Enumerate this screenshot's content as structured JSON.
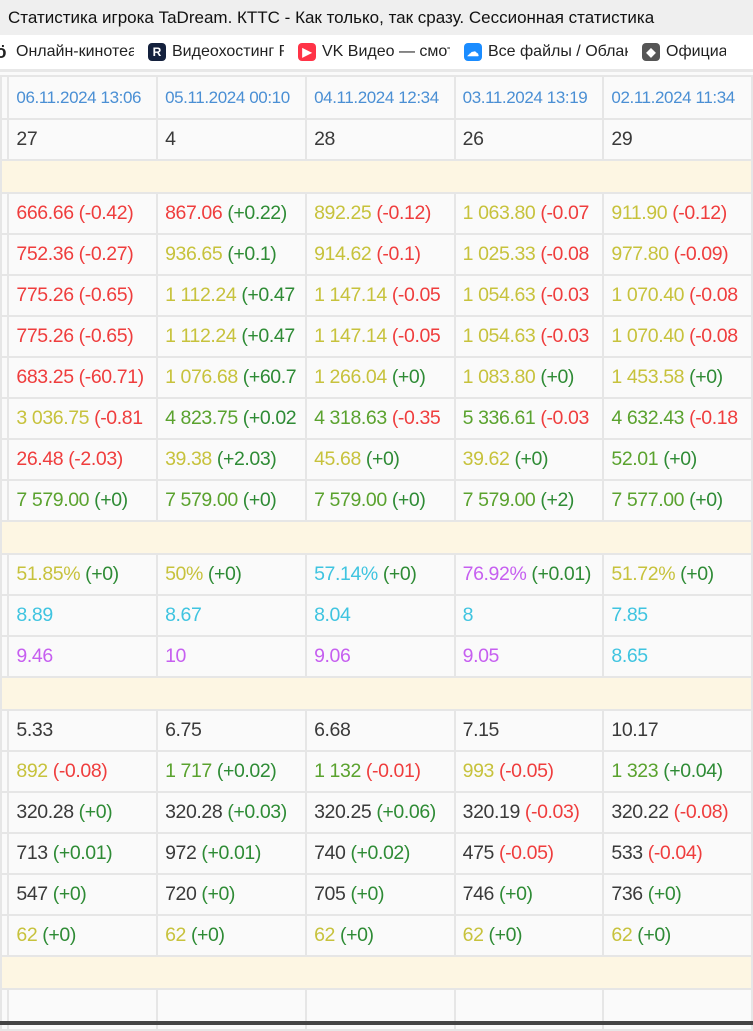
{
  "window": {
    "title": "Статистика игрока TaDream. КТТС - Как только, так сразу. Сессионная статистика"
  },
  "bookmarks": [
    {
      "label": "Онлайн-кинотеатр",
      "icon": "kinopoisk-icon",
      "color": "#222222",
      "glyph": "ö"
    },
    {
      "label": "Видеохостинг RUTUBE",
      "icon": "rutube-icon",
      "color": "#14213d",
      "glyph": "R"
    },
    {
      "label": "VK Видео — смотреть",
      "icon": "vk-video-icon",
      "color": "#ff3347",
      "glyph": "▶"
    },
    {
      "label": "Все файлы / Облако",
      "icon": "cloud-icon",
      "color": "#1a8cff",
      "glyph": "☁"
    },
    {
      "label": "Официальный",
      "icon": "shield-icon",
      "color": "#555555",
      "glyph": "◆"
    }
  ],
  "colors": {
    "red": "#ef3d3d",
    "yellow": "#c7c23c",
    "green": "#5aa22e",
    "dgreen": "#2e8b35",
    "cyan": "#3fc4e0",
    "purple": "#c65ff0",
    "dark": "#3a3a3a"
  },
  "table": {
    "dates": [
      "06.11.2024 13:06",
      "05.11.2024 00:10",
      "04.11.2024 12:34",
      "03.11.2024 13:19",
      "02.11.2024 11:34"
    ],
    "sections": [
      {
        "rows": [
          [
            {
              "v": "27",
              "vc": "dark"
            },
            {
              "v": "4",
              "vc": "dark"
            },
            {
              "v": "28",
              "vc": "dark"
            },
            {
              "v": "26",
              "vc": "dark"
            },
            {
              "v": "29",
              "vc": "dark"
            }
          ]
        ]
      },
      {
        "rows": [
          [
            {
              "v": "666.66",
              "vc": "red",
              "d": "(-0.42)",
              "dc": "red"
            },
            {
              "v": "867.06",
              "vc": "red",
              "d": "(+0.22)",
              "dc": "dgreen"
            },
            {
              "v": "892.25",
              "vc": "yellow",
              "d": "(-0.12)",
              "dc": "red"
            },
            {
              "v": "1 063.80",
              "vc": "yellow",
              "d": "(-0.07",
              "dc": "red"
            },
            {
              "v": "911.90",
              "vc": "yellow",
              "d": "(-0.12)",
              "dc": "red"
            }
          ],
          [
            {
              "v": "752.36",
              "vc": "red",
              "d": "(-0.27)",
              "dc": "red"
            },
            {
              "v": "936.65",
              "vc": "yellow",
              "d": "(+0.1)",
              "dc": "dgreen"
            },
            {
              "v": "914.62",
              "vc": "yellow",
              "d": "(-0.1)",
              "dc": "red"
            },
            {
              "v": "1 025.33",
              "vc": "yellow",
              "d": "(-0.08",
              "dc": "red"
            },
            {
              "v": "977.80",
              "vc": "yellow",
              "d": "(-0.09)",
              "dc": "red"
            }
          ],
          [
            {
              "v": "775.26",
              "vc": "red",
              "d": "(-0.65)",
              "dc": "red"
            },
            {
              "v": "1 112.24",
              "vc": "yellow",
              "d": "(+0.47",
              "dc": "dgreen"
            },
            {
              "v": "1 147.14",
              "vc": "yellow",
              "d": "(-0.05",
              "dc": "red"
            },
            {
              "v": "1 054.63",
              "vc": "yellow",
              "d": "(-0.03",
              "dc": "red"
            },
            {
              "v": "1 070.40",
              "vc": "yellow",
              "d": "(-0.08",
              "dc": "red"
            }
          ],
          [
            {
              "v": "775.26",
              "vc": "red",
              "d": "(-0.65)",
              "dc": "red"
            },
            {
              "v": "1 112.24",
              "vc": "yellow",
              "d": "(+0.47",
              "dc": "dgreen"
            },
            {
              "v": "1 147.14",
              "vc": "yellow",
              "d": "(-0.05",
              "dc": "red"
            },
            {
              "v": "1 054.63",
              "vc": "yellow",
              "d": "(-0.03",
              "dc": "red"
            },
            {
              "v": "1 070.40",
              "vc": "yellow",
              "d": "(-0.08",
              "dc": "red"
            }
          ],
          [
            {
              "v": "683.25",
              "vc": "red",
              "d": "(-60.71)",
              "dc": "red"
            },
            {
              "v": "1 076.68",
              "vc": "yellow",
              "d": "(+60.7",
              "dc": "dgreen"
            },
            {
              "v": "1 266.04",
              "vc": "yellow",
              "d": "(+0)",
              "dc": "dgreen"
            },
            {
              "v": "1 083.80",
              "vc": "yellow",
              "d": "(+0)",
              "dc": "dgreen"
            },
            {
              "v": "1 453.58",
              "vc": "yellow",
              "d": "(+0)",
              "dc": "dgreen"
            }
          ],
          [
            {
              "v": "3 036.75",
              "vc": "yellow",
              "d": "(-0.81",
              "dc": "red"
            },
            {
              "v": "4 823.75",
              "vc": "green",
              "d": "(+0.02",
              "dc": "dgreen"
            },
            {
              "v": "4 318.63",
              "vc": "green",
              "d": "(-0.35",
              "dc": "red"
            },
            {
              "v": "5 336.61",
              "vc": "green",
              "d": "(-0.03",
              "dc": "red"
            },
            {
              "v": "4 632.43",
              "vc": "green",
              "d": "(-0.18",
              "dc": "red"
            }
          ],
          [
            {
              "v": "26.48",
              "vc": "red",
              "d": "(-2.03)",
              "dc": "red"
            },
            {
              "v": "39.38",
              "vc": "yellow",
              "d": "(+2.03)",
              "dc": "dgreen"
            },
            {
              "v": "45.68",
              "vc": "yellow",
              "d": "(+0)",
              "dc": "dgreen"
            },
            {
              "v": "39.62",
              "vc": "yellow",
              "d": "(+0)",
              "dc": "dgreen"
            },
            {
              "v": "52.01",
              "vc": "green",
              "d": "(+0)",
              "dc": "dgreen"
            }
          ],
          [
            {
              "v": "7 579.00",
              "vc": "green",
              "d": "(+0)",
              "dc": "dgreen"
            },
            {
              "v": "7 579.00",
              "vc": "green",
              "d": "(+0)",
              "dc": "dgreen"
            },
            {
              "v": "7 579.00",
              "vc": "green",
              "d": "(+0)",
              "dc": "dgreen"
            },
            {
              "v": "7 579.00",
              "vc": "green",
              "d": "(+2)",
              "dc": "dgreen"
            },
            {
              "v": "7 577.00",
              "vc": "green",
              "d": "(+0)",
              "dc": "dgreen"
            }
          ]
        ]
      },
      {
        "rows": [
          [
            {
              "v": "51.85%",
              "vc": "yellow",
              "d": "(+0)",
              "dc": "dgreen"
            },
            {
              "v": "50%",
              "vc": "yellow",
              "d": "(+0)",
              "dc": "dgreen"
            },
            {
              "v": "57.14%",
              "vc": "cyan",
              "d": "(+0)",
              "dc": "dgreen"
            },
            {
              "v": "76.92%",
              "vc": "purple",
              "d": "(+0.01)",
              "dc": "dgreen"
            },
            {
              "v": "51.72%",
              "vc": "yellow",
              "d": "(+0)",
              "dc": "dgreen"
            }
          ],
          [
            {
              "v": "8.89",
              "vc": "cyan"
            },
            {
              "v": "8.67",
              "vc": "cyan"
            },
            {
              "v": "8.04",
              "vc": "cyan"
            },
            {
              "v": "8",
              "vc": "cyan"
            },
            {
              "v": "7.85",
              "vc": "cyan"
            }
          ],
          [
            {
              "v": "9.46",
              "vc": "purple"
            },
            {
              "v": "10",
              "vc": "purple"
            },
            {
              "v": "9.06",
              "vc": "purple"
            },
            {
              "v": "9.05",
              "vc": "purple"
            },
            {
              "v": "8.65",
              "vc": "cyan"
            }
          ]
        ]
      },
      {
        "rows": [
          [
            {
              "v": "5.33",
              "vc": "dark"
            },
            {
              "v": "6.75",
              "vc": "dark"
            },
            {
              "v": "6.68",
              "vc": "dark"
            },
            {
              "v": "7.15",
              "vc": "dark"
            },
            {
              "v": "10.17",
              "vc": "dark"
            }
          ],
          [
            {
              "v": "892",
              "vc": "yellow",
              "d": "(-0.08)",
              "dc": "red"
            },
            {
              "v": "1 717",
              "vc": "green",
              "d": "(+0.02)",
              "dc": "dgreen"
            },
            {
              "v": "1 132",
              "vc": "green",
              "d": "(-0.01)",
              "dc": "red"
            },
            {
              "v": "993",
              "vc": "yellow",
              "d": "(-0.05)",
              "dc": "red"
            },
            {
              "v": "1 323",
              "vc": "green",
              "d": "(+0.04)",
              "dc": "dgreen"
            }
          ],
          [
            {
              "v": "320.28",
              "vc": "dark",
              "d": "(+0)",
              "dc": "dgreen"
            },
            {
              "v": "320.28",
              "vc": "dark",
              "d": "(+0.03)",
              "dc": "dgreen"
            },
            {
              "v": "320.25",
              "vc": "dark",
              "d": "(+0.06)",
              "dc": "dgreen"
            },
            {
              "v": "320.19",
              "vc": "dark",
              "d": "(-0.03)",
              "dc": "red"
            },
            {
              "v": "320.22",
              "vc": "dark",
              "d": "(-0.08)",
              "dc": "red"
            }
          ],
          [
            {
              "v": "713",
              "vc": "dark",
              "d": "(+0.01)",
              "dc": "dgreen"
            },
            {
              "v": "972",
              "vc": "dark",
              "d": "(+0.01)",
              "dc": "dgreen"
            },
            {
              "v": "740",
              "vc": "dark",
              "d": "(+0.02)",
              "dc": "dgreen"
            },
            {
              "v": "475",
              "vc": "dark",
              "d": "(-0.05)",
              "dc": "red"
            },
            {
              "v": "533",
              "vc": "dark",
              "d": "(-0.04)",
              "dc": "red"
            }
          ],
          [
            {
              "v": "547",
              "vc": "dark",
              "d": "(+0)",
              "dc": "dgreen"
            },
            {
              "v": "720",
              "vc": "dark",
              "d": "(+0)",
              "dc": "dgreen"
            },
            {
              "v": "705",
              "vc": "dark",
              "d": "(+0)",
              "dc": "dgreen"
            },
            {
              "v": "746",
              "vc": "dark",
              "d": "(+0)",
              "dc": "dgreen"
            },
            {
              "v": "736",
              "vc": "dark",
              "d": "(+0)",
              "dc": "dgreen"
            }
          ],
          [
            {
              "v": "62",
              "vc": "yellow",
              "d": "(+0)",
              "dc": "dgreen"
            },
            {
              "v": "62",
              "vc": "yellow",
              "d": "(+0)",
              "dc": "dgreen"
            },
            {
              "v": "62",
              "vc": "yellow",
              "d": "(+0)",
              "dc": "dgreen"
            },
            {
              "v": "62",
              "vc": "yellow",
              "d": "(+0)",
              "dc": "dgreen"
            },
            {
              "v": "62",
              "vc": "yellow",
              "d": "(+0)",
              "dc": "dgreen"
            }
          ]
        ]
      }
    ]
  }
}
